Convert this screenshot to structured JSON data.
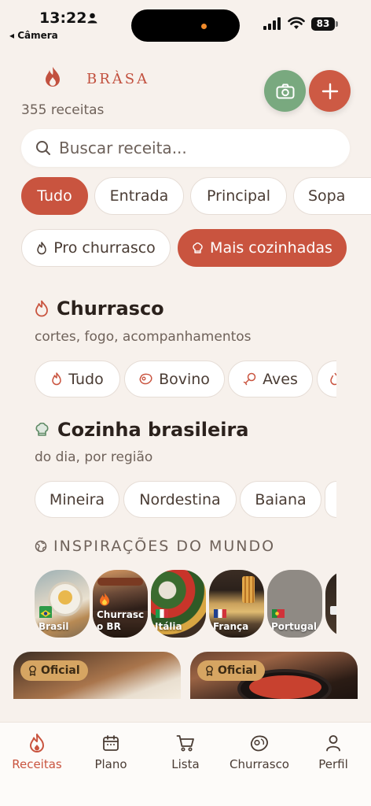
{
  "status_bar": {
    "time": "13:22",
    "back_label": "◂ Câmera",
    "battery": "83"
  },
  "header": {
    "brand": "BRÀSA",
    "recipe_count": "355 receitas"
  },
  "search": {
    "placeholder": "Buscar receita..."
  },
  "category_chips": [
    "Tudo",
    "Entrada",
    "Principal",
    "Sopa"
  ],
  "mode_chips": {
    "barbecue": "Pro churrasco",
    "most_cooked": "Mais cozinhadas"
  },
  "churrasco": {
    "title": "Churrasco",
    "subtitle": "cortes, fogo, acompanhamentos",
    "chips": [
      "Tudo",
      "Bovino",
      "Aves"
    ]
  },
  "brasileira": {
    "title": "Cozinha brasileira",
    "subtitle": "do dia, por região",
    "chips": [
      "Mineira",
      "Nordestina",
      "Baiana"
    ]
  },
  "world": {
    "title": "INSPIRAÇÕES DO MUNDO",
    "cards": [
      {
        "label": "Brasil"
      },
      {
        "label": "Churrasc o BR"
      },
      {
        "label": "Itália"
      },
      {
        "label": "França"
      },
      {
        "label": "Portugal"
      }
    ]
  },
  "featured": {
    "badge": "Oficial"
  },
  "tabs": [
    "Receitas",
    "Plano",
    "Lista",
    "Churrasco",
    "Perfil"
  ],
  "colors": {
    "accent": "#c9543f",
    "green": "#79a97f",
    "background": "#f7f1ec",
    "badge": "#d6a562"
  }
}
